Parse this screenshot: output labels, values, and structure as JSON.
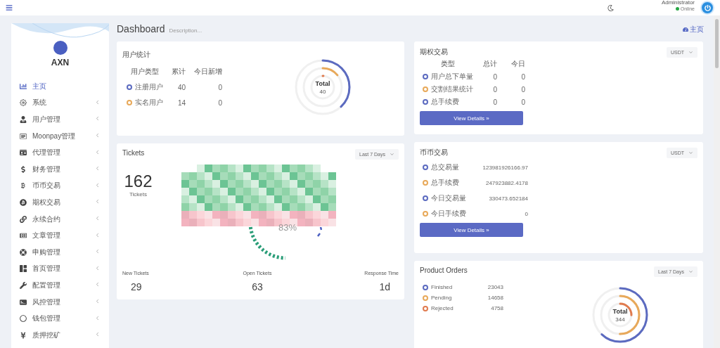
{
  "topbar": {
    "user_name": "Administrator",
    "status": "Online"
  },
  "sidebar": {
    "brand": "AXN",
    "items": [
      {
        "label": "主页",
        "selected": true,
        "chevron": false
      },
      {
        "label": "系统",
        "selected": false,
        "chevron": true
      },
      {
        "label": "用户管理",
        "selected": false,
        "chevron": true
      },
      {
        "label": "Moonpay管理",
        "selected": false,
        "chevron": true
      },
      {
        "label": "代理管理",
        "selected": false,
        "chevron": true
      },
      {
        "label": "财务管理",
        "selected": false,
        "chevron": true
      },
      {
        "label": "币币交易",
        "selected": false,
        "chevron": true
      },
      {
        "label": "期权交易",
        "selected": false,
        "chevron": true
      },
      {
        "label": "永续合约",
        "selected": false,
        "chevron": true
      },
      {
        "label": "文章管理",
        "selected": false,
        "chevron": true
      },
      {
        "label": "申购管理",
        "selected": false,
        "chevron": true
      },
      {
        "label": "首页管理",
        "selected": false,
        "chevron": true
      },
      {
        "label": "配置管理",
        "selected": false,
        "chevron": true
      },
      {
        "label": "风控管理",
        "selected": false,
        "chevron": true
      },
      {
        "label": "钱包管理",
        "selected": false,
        "chevron": true
      },
      {
        "label": "质押挖矿",
        "selected": false,
        "chevron": true
      }
    ]
  },
  "page": {
    "title": "Dashboard",
    "description": "Description...",
    "breadcrumb": "主页"
  },
  "user_stats": {
    "title": "用户统计",
    "columns": [
      "用户类型",
      "累计",
      "今日新增"
    ],
    "rows": [
      {
        "type": "注册用户",
        "total": "40",
        "today": "0",
        "color": "#5c6bc0"
      },
      {
        "type": "实名用户",
        "total": "14",
        "today": "0",
        "color": "#e8a95a"
      }
    ],
    "ring": {
      "label": "Total",
      "value": "40"
    }
  },
  "tickets": {
    "title": "Tickets",
    "period": "Last 7 Days",
    "total": "162",
    "total_label": "Tickets",
    "gauge_value": "83%",
    "stats": [
      {
        "label": "New Tickets",
        "value": "29"
      },
      {
        "label": "Open Tickets",
        "value": "63"
      },
      {
        "label": "Response Time",
        "value": "1d"
      }
    ]
  },
  "options_trading": {
    "title": "期权交易",
    "currency": "USDT",
    "columns": [
      "类型",
      "总计",
      "今日"
    ],
    "rows": [
      {
        "type": "用户总下单量",
        "total": "0",
        "today": "0",
        "color": "#5c6bc0"
      },
      {
        "type": "交割结果统计",
        "total": "0",
        "today": "0",
        "color": "#e8a95a"
      },
      {
        "type": "总手续费",
        "total": "0",
        "today": "0",
        "color": "#5c6bc0"
      }
    ],
    "button": "View Details »"
  },
  "spot_trading": {
    "title": "币币交易",
    "currency": "USDT",
    "rows": [
      {
        "label": "总交易量",
        "value": "123981926166.97",
        "color": "#5c6bc0"
      },
      {
        "label": "总手续费",
        "value": "247923882.4178",
        "color": "#e8a95a"
      },
      {
        "label": "今日交易量",
        "value": "330473.652184",
        "color": "#5c6bc0"
      },
      {
        "label": "今日手续费",
        "value": "0",
        "color": "#e8a95a"
      }
    ],
    "button": "View Details »"
  },
  "product_orders": {
    "title": "Product Orders",
    "period": "Last 7 Days",
    "rows": [
      {
        "label": "Finished",
        "value": "23043",
        "color": "#5c6bc0"
      },
      {
        "label": "Pending",
        "value": "14658",
        "color": "#e8a95a"
      },
      {
        "label": "Rejected",
        "value": "4758",
        "color": "#e07b4f"
      }
    ],
    "ring": {
      "label": "Total",
      "value": "344"
    }
  }
}
